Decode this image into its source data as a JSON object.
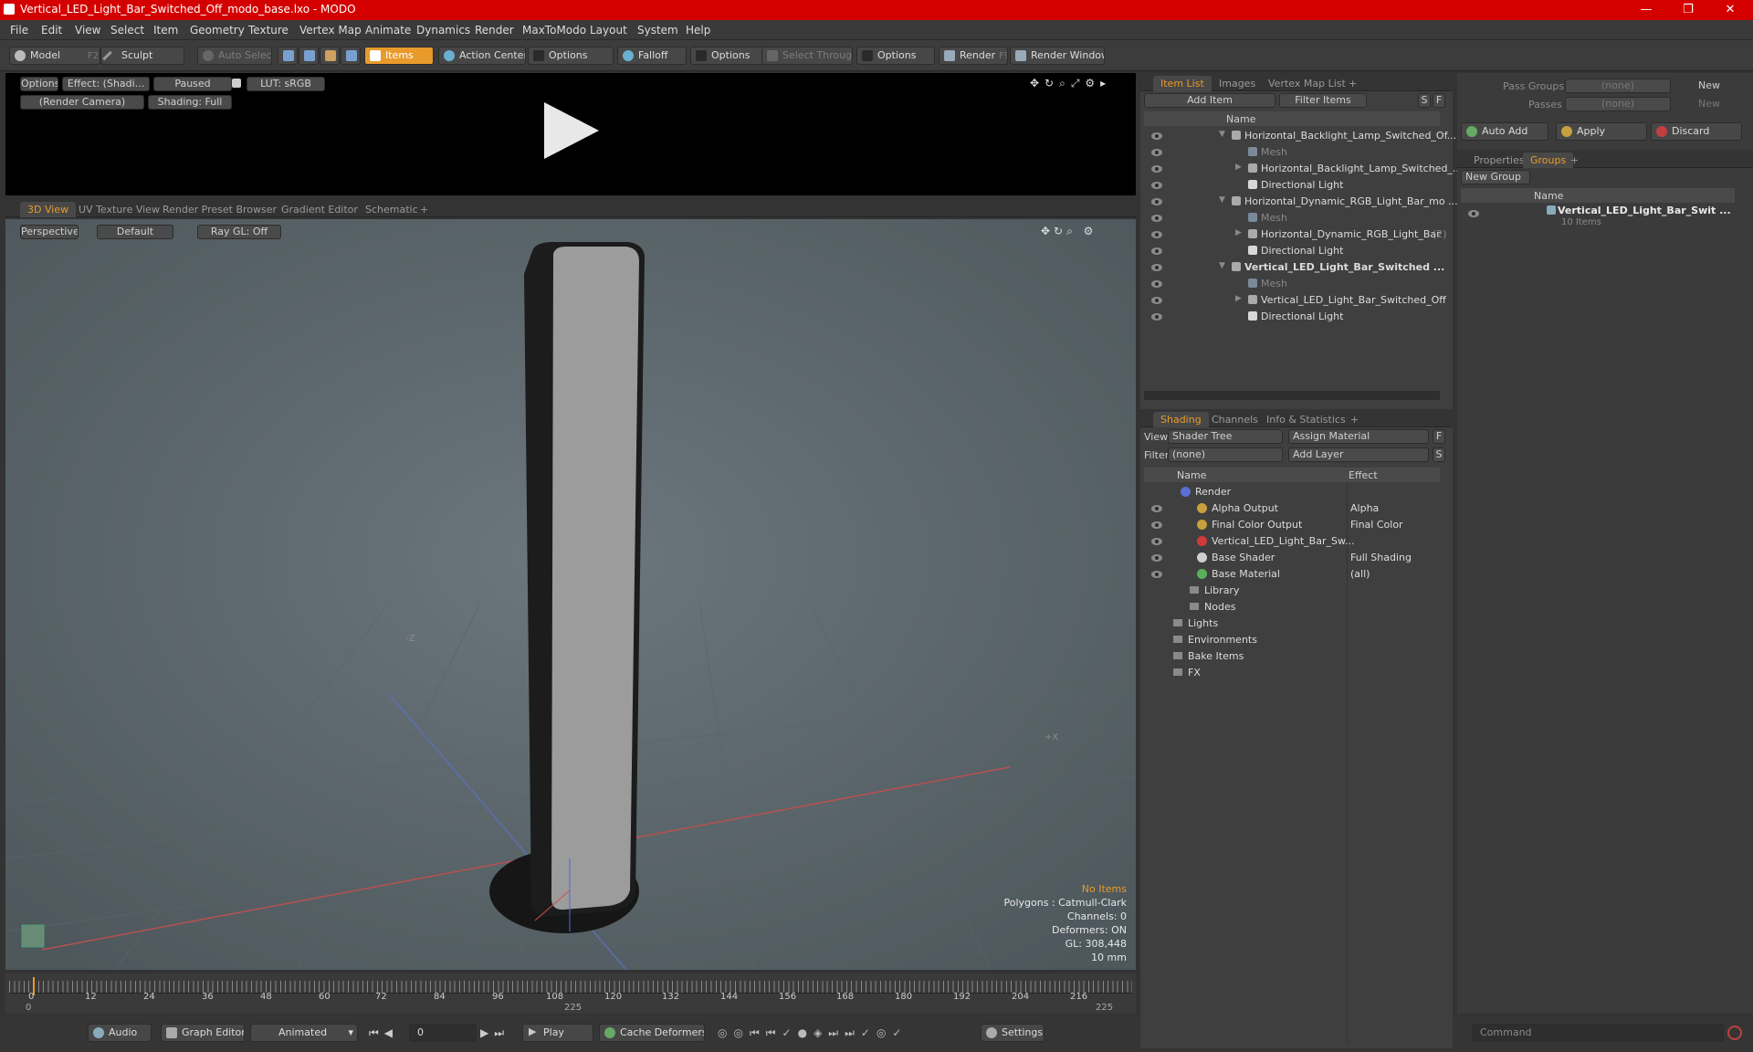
{
  "window": {
    "title": "Vertical_LED_Light_Bar_Switched_Off_modo_base.lxo - MODO",
    "min": "—",
    "max": "❐",
    "close": "✕"
  },
  "menu": [
    "File",
    "Edit",
    "View",
    "Select",
    "Item",
    "Geometry",
    "Texture",
    "Vertex Map",
    "Animate",
    "Dynamics",
    "Render",
    "MaxToModo",
    "Layout",
    "System",
    "Help"
  ],
  "toolbar": {
    "model": "Model",
    "model_key": "F2",
    "sculpt": "Sculpt",
    "auto_select": "Auto Select",
    "items": "Items",
    "action_center": "Action Center",
    "options1": "Options",
    "falloff": "Falloff",
    "options2": "Options",
    "select_through": "Select Through",
    "options3": "Options",
    "render": "Render",
    "render_key": "F9",
    "render_window": "Render Window"
  },
  "preview": {
    "options": "Options",
    "effect": "Effect: (Shadi...",
    "paused": "Paused",
    "lut": "LUT: sRGB",
    "camera": "(Render Camera)",
    "shading": "Shading: Full"
  },
  "viewport_tabs": [
    "3D View",
    "UV Texture View",
    "Render Preset Browser",
    "Gradient Editor",
    "Schematic"
  ],
  "viewport": {
    "perspective": "Perspective",
    "default": "Default",
    "raygl": "Ray GL: Off",
    "axis_z": "-Z",
    "axis_x": "+X",
    "stats": [
      "No Items",
      "Polygons : Catmull-Clark",
      "Channels: 0",
      "Deformers: ON",
      "GL: 308,448",
      "10 mm"
    ]
  },
  "timeline": {
    "ticks": [
      "0",
      "12",
      "24",
      "36",
      "48",
      "60",
      "72",
      "84",
      "96",
      "108",
      "120",
      "132",
      "144",
      "156",
      "168",
      "180",
      "192",
      "204",
      "216"
    ],
    "start": "0",
    "mid": "225",
    "end": "225"
  },
  "transport": {
    "audio": "Audio",
    "graph_editor": "Graph Editor",
    "animated": "Animated",
    "frame": "0",
    "play": "Play",
    "cache": "Cache Deformers",
    "settings": "Settings",
    "command": "Command"
  },
  "item_list": {
    "tabs": [
      "Item List",
      "Images",
      "Vertex Map List"
    ],
    "add_item": "Add Item",
    "filter": "Filter Items",
    "s": "S",
    "f": "F",
    "col_name": "Name",
    "rows": [
      {
        "label": "Horizontal_Backlight_Lamp_Switched_Of...",
        "type": "group",
        "indent": 0,
        "bold": false
      },
      {
        "label": "Mesh",
        "type": "mesh",
        "indent": 1,
        "bold": false
      },
      {
        "label": "Horizontal_Backlight_Lamp_Switched_...",
        "type": "item",
        "indent": 1,
        "bold": false
      },
      {
        "label": "Directional Light",
        "type": "light",
        "indent": 1,
        "bold": false
      },
      {
        "label": "Horizontal_Dynamic_RGB_Light_Bar_mo ...",
        "type": "group",
        "indent": 0,
        "bold": false
      },
      {
        "label": "Mesh",
        "type": "mesh",
        "indent": 1,
        "bold": false
      },
      {
        "label": "Horizontal_Dynamic_RGB_Light_Bar",
        "type": "item",
        "indent": 1,
        "bold": false,
        "count": "(2)"
      },
      {
        "label": "Directional Light",
        "type": "light",
        "indent": 1,
        "bold": false
      },
      {
        "label": "Vertical_LED_Light_Bar_Switched ...",
        "type": "group",
        "indent": 0,
        "bold": true
      },
      {
        "label": "Mesh",
        "type": "mesh",
        "indent": 1,
        "bold": false
      },
      {
        "label": "Vertical_LED_Light_Bar_Switched_Off",
        "type": "item",
        "indent": 1,
        "bold": false
      },
      {
        "label": "Directional Light",
        "type": "light",
        "indent": 1,
        "bold": false
      }
    ]
  },
  "shading": {
    "tabs": [
      "Shading",
      "Channels",
      "Info & Statistics"
    ],
    "view_label": "View",
    "view_value": "Shader Tree",
    "assign": "Assign Material",
    "f": "F",
    "filter_label": "Filter",
    "filter_value": "(none)",
    "add_layer": "Add Layer",
    "s": "S",
    "col_name": "Name",
    "col_effect": "Effect",
    "rows": [
      {
        "label": "Render",
        "effect": "",
        "indent": 0,
        "color": "#5a6fd0"
      },
      {
        "label": "Alpha Output",
        "effect": "Alpha",
        "indent": 1,
        "color": "#c8a040"
      },
      {
        "label": "Final Color Output",
        "effect": "Final Color",
        "indent": 1,
        "color": "#c8a040"
      },
      {
        "label": "Vertical_LED_Light_Bar_Sw...",
        "effect": "",
        "indent": 1,
        "color": "#d03a3a"
      },
      {
        "label": "Base Shader",
        "effect": "Full Shading",
        "indent": 1,
        "color": "#cfcfcf"
      },
      {
        "label": "Base Material",
        "effect": "(all)",
        "indent": 1,
        "color": "#5ab05a"
      },
      {
        "label": "Library",
        "effect": "",
        "indent": 1,
        "color": ""
      },
      {
        "label": "Nodes",
        "effect": "",
        "indent": 1,
        "color": ""
      },
      {
        "label": "Lights",
        "effect": "",
        "indent": 0,
        "color": ""
      },
      {
        "label": "Environments",
        "effect": "",
        "indent": 0,
        "color": ""
      },
      {
        "label": "Bake Items",
        "effect": "",
        "indent": 0,
        "color": ""
      },
      {
        "label": "FX",
        "effect": "",
        "indent": 0,
        "color": ""
      }
    ]
  },
  "groups": {
    "pass_groups": "Pass Groups",
    "passes": "Passes",
    "none": "(none)",
    "new": "New",
    "auto_add": "Auto Add",
    "apply": "Apply",
    "discard": "Discard",
    "tabs": [
      "Properties",
      "Groups"
    ],
    "new_group": "New Group",
    "col_name": "Name",
    "group_name": "Vertical_LED_Light_Bar_Swit ...",
    "group_count": "10 Items"
  }
}
